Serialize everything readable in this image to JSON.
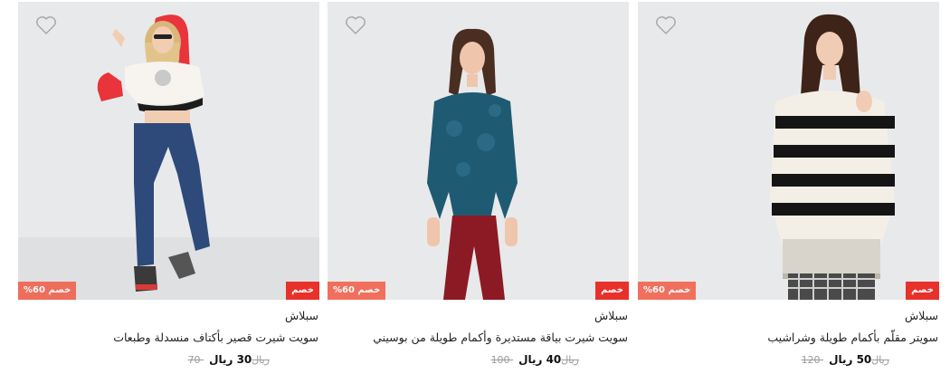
{
  "colors": {
    "photo_bg": "#e8e9eb",
    "sale_badge": "#e8312a",
    "discount_badge": "#f2563f"
  },
  "products": [
    {
      "badge_discount": "%60 خصم",
      "badge_sale": "خصم",
      "brand": "سبلاش",
      "title": "سويت شيرت قصير بأكتاف منسدلة وطبعات",
      "old_price": "70 ريال",
      "new_price": "30 ريال",
      "icon": "heart-icon"
    },
    {
      "badge_discount": "%60 خصم",
      "badge_sale": "خصم",
      "brand": "سبلاش",
      "title": "سويت شيرت بياقة مستديرة وأكمام طويلة من بوسيني",
      "old_price": "100 ريال",
      "new_price": "40 ريال",
      "icon": "heart-icon"
    },
    {
      "badge_discount": "%60 خصم",
      "badge_sale": "خصم",
      "brand": "سبلاش",
      "title": "سويتر مقلّم بأكمام طويلة وشراشيب",
      "old_price": "120 ريال",
      "new_price": "50 ريال",
      "icon": "heart-icon"
    }
  ]
}
